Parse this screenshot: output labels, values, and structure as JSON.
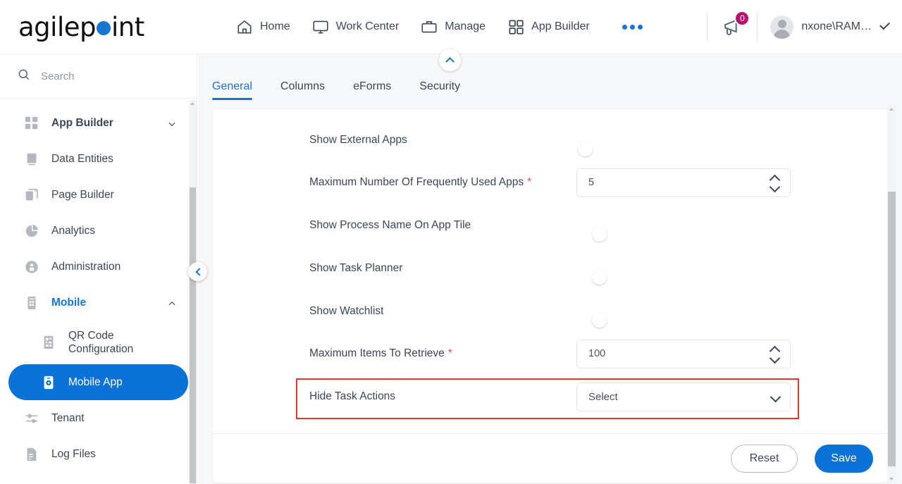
{
  "brand": {
    "name_part1": "agilep",
    "name_dot": "o",
    "name_part2": "int",
    "accent_color": "#1676d2"
  },
  "header": {
    "nav": [
      {
        "label": "Home",
        "icon": "home-icon"
      },
      {
        "label": "Work Center",
        "icon": "monitor-icon"
      },
      {
        "label": "Manage",
        "icon": "briefcase-icon"
      },
      {
        "label": "App Builder",
        "icon": "grid-icon"
      }
    ],
    "more_icon": "ellipsis-icon",
    "notification": {
      "icon": "megaphone-icon",
      "count": "0",
      "badge_color": "#b4146b"
    },
    "user": {
      "name": "nxone\\RAM…",
      "avatar_icon": "user-avatar-icon",
      "caret_icon": "chevron-down-icon"
    }
  },
  "sidebar": {
    "search": {
      "placeholder": "Search",
      "icon": "search-icon"
    },
    "items": [
      {
        "label": "App Builder",
        "icon": "grid-check-icon",
        "expandable": true,
        "expanded": false,
        "chevron": "chevron-down-icon"
      },
      {
        "label": "Data Entities",
        "icon": "database-icon",
        "expandable": false
      },
      {
        "label": "Page Builder",
        "icon": "pages-icon",
        "expandable": false
      },
      {
        "label": "Analytics",
        "icon": "pie-chart-icon",
        "expandable": false
      },
      {
        "label": "Administration",
        "icon": "user-lock-icon",
        "expandable": false
      },
      {
        "label": "Mobile",
        "icon": "mobile-icon",
        "expandable": true,
        "expanded": true,
        "chevron": "chevron-up-icon",
        "active_parent": true
      },
      {
        "label": "QR Code Configuration",
        "icon": "qr-code-icon",
        "sub": true
      },
      {
        "label": "Mobile App",
        "icon": "mobile-gear-icon",
        "sub": true,
        "selected": true
      },
      {
        "label": "Tenant",
        "icon": "sliders-icon"
      },
      {
        "label": "Log Files",
        "icon": "document-icon"
      }
    ],
    "collapse_handle_icon": "chevron-left-icon"
  },
  "main": {
    "collapse_top_icon": "chevron-up-icon",
    "tabs": [
      {
        "label": "General",
        "active": true
      },
      {
        "label": "Columns",
        "active": false
      },
      {
        "label": "eForms",
        "active": false
      },
      {
        "label": "Security",
        "active": false
      }
    ],
    "fields": [
      {
        "label": "Show External Apps",
        "required": false,
        "type": "toggle",
        "value": "off"
      },
      {
        "label": "Maximum Number Of Frequently Used Apps",
        "required": true,
        "type": "number",
        "value": "5"
      },
      {
        "label": "Show Process Name On App Tile",
        "required": false,
        "type": "toggle",
        "value": "on"
      },
      {
        "label": "Show Task Planner",
        "required": false,
        "type": "toggle",
        "value": "on"
      },
      {
        "label": "Show Watchlist",
        "required": false,
        "type": "toggle",
        "value": "on"
      },
      {
        "label": "Maximum Items To Retrieve",
        "required": true,
        "type": "number",
        "value": "100"
      },
      {
        "label": "Hide Task Actions",
        "required": false,
        "type": "select",
        "value": "Select",
        "highlighted": true
      }
    ],
    "required_marker": "*",
    "highlight_color": "#e8352c",
    "buttons": {
      "reset": "Reset",
      "save": "Save"
    }
  }
}
